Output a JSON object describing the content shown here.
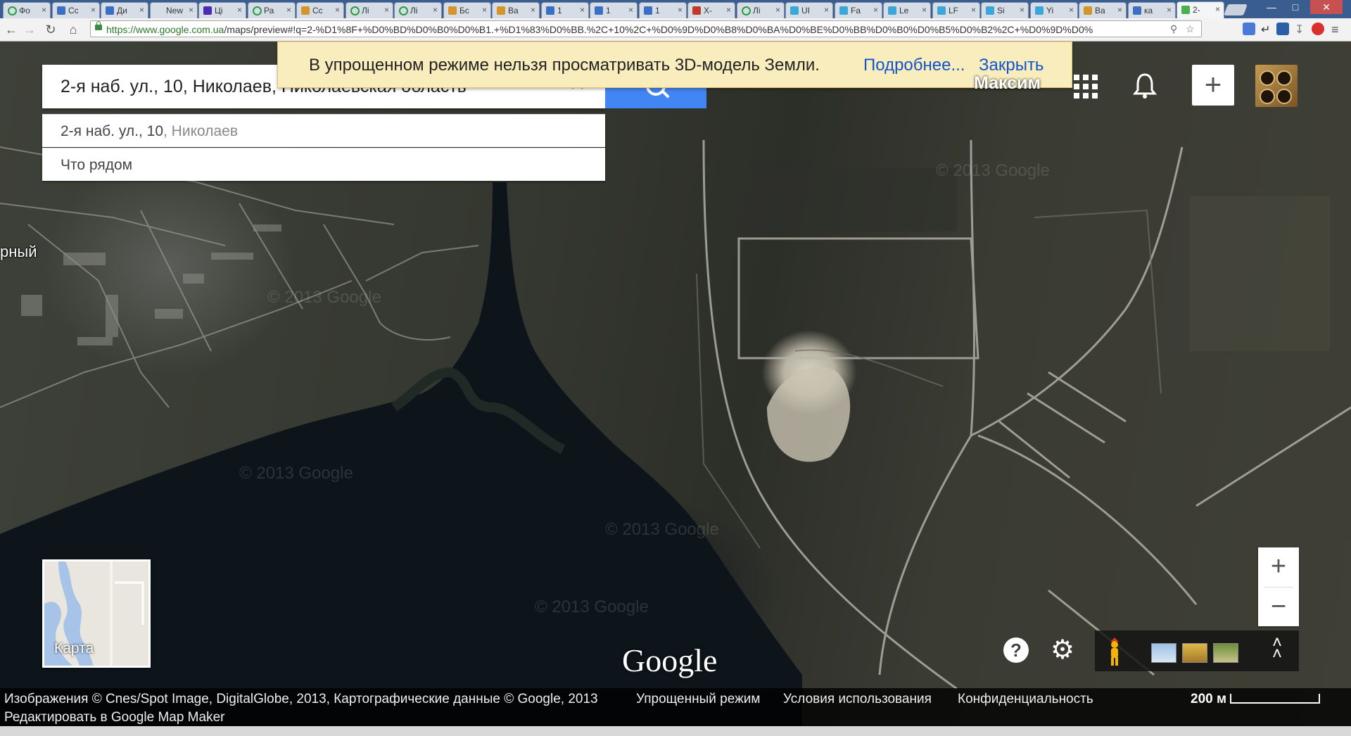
{
  "browser": {
    "tabs": [
      {
        "label": "Фо",
        "fav": "#2a9d3e",
        "ring": true
      },
      {
        "label": "Сс",
        "fav": "#3b6fc4"
      },
      {
        "label": "Ди",
        "fav": "#3b6fc4"
      },
      {
        "label": "New",
        "fav": "#d7dde6"
      },
      {
        "label": "Ці",
        "fav": "#4a2bb5"
      },
      {
        "label": "Ра",
        "fav": "#2a9d3e",
        "ring": true
      },
      {
        "label": "Сс",
        "fav": "#d4962b"
      },
      {
        "label": "Лі",
        "fav": "#2a9d3e",
        "ring": true
      },
      {
        "label": "Лі",
        "fav": "#2a9d3e",
        "ring": true
      },
      {
        "label": "Бс",
        "fav": "#d4962b"
      },
      {
        "label": "Ва",
        "fav": "#d4962b"
      },
      {
        "label": "1",
        "fav": "#3b6fc4"
      },
      {
        "label": "1",
        "fav": "#3b6fc4"
      },
      {
        "label": "1",
        "fav": "#3b6fc4"
      },
      {
        "label": "Х-",
        "fav": "#c0392b"
      },
      {
        "label": "Лі",
        "fav": "#2a9d3e",
        "ring": true
      },
      {
        "label": "UI",
        "fav": "#3aa7d8"
      },
      {
        "label": "Fa",
        "fav": "#3aa7d8"
      },
      {
        "label": "Le",
        "fav": "#3aa7d8"
      },
      {
        "label": "LF",
        "fav": "#3aa7d8"
      },
      {
        "label": "Si",
        "fav": "#3aa7d8"
      },
      {
        "label": "Yi",
        "fav": "#3aa7d8"
      },
      {
        "label": "Ba",
        "fav": "#d4962b"
      },
      {
        "label": "ка",
        "fav": "#3b6fc4"
      },
      {
        "label": "2-",
        "fav": "#4caf50",
        "active": true
      }
    ],
    "url_host": "https://www.google.com.ua",
    "url_rest": "/maps/preview#!q=2-%D1%8F+%D0%BD%D0%B0%D0%B1.+%D1%83%D0%BB.%2C+10%2C+%D0%9D%D0%B8%D0%BA%D0%BE%D0%BB%D0%B0%D0%B5%D0%B2%2C+%D0%9D%D0%"
  },
  "search": {
    "query": "2-я наб. ул., 10, Николаев, Николаевская область",
    "suggestions": [
      {
        "main": "2-я наб. ул., 10",
        "secondary": ", Николаев"
      },
      {
        "main": "Что рядом",
        "secondary": ""
      }
    ]
  },
  "notice": {
    "message": "В упрощенном режиме нельзя просматривать 3D-модель Земли.",
    "more_link": "Подробнее...",
    "close_link": "Закрыть"
  },
  "account": {
    "username": "Максим"
  },
  "map": {
    "place_label": "рный",
    "watermarks": [
      "© 2013 Google",
      "© 2013 Google",
      "© 2013 Google",
      "© 2013 Google",
      "© 2013 Google"
    ],
    "minimap_label": "Карта",
    "logo": "Google"
  },
  "footer": {
    "imagery": "Изображения © Cnes/Spot Image, DigitalGlobe, 2013, Картографические данные © Google, 2013",
    "lite_mode": "Упрощенный режим",
    "terms": "Условия использования",
    "privacy": "Конфиденциальность",
    "edit": "Редактировать в Google Map Maker",
    "scale": "200 м"
  },
  "colors": {
    "accent": "#4285f4",
    "link": "#1155cc",
    "notice_bg": "#f9edbe"
  }
}
